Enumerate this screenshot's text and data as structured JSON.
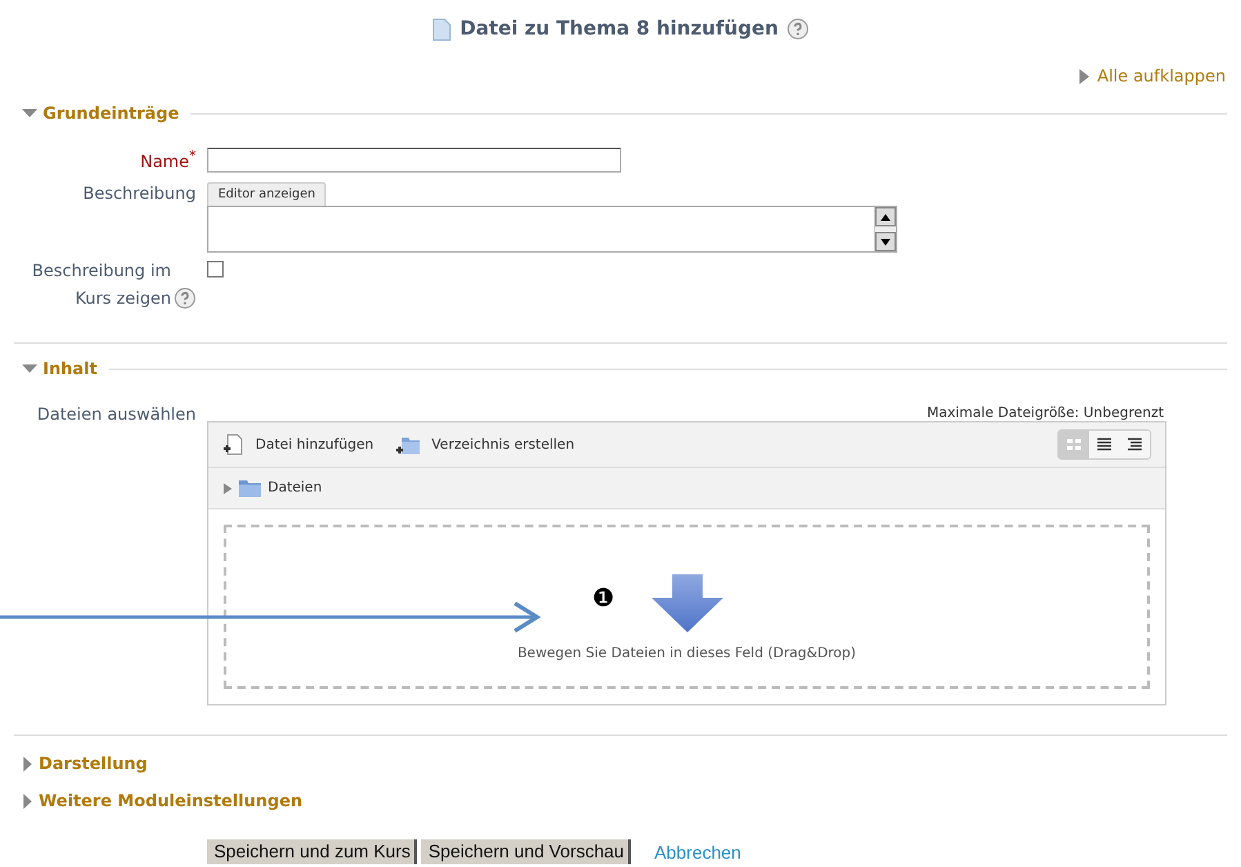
{
  "page_title": "Datei zu Thema 8 hinzufügen",
  "expand_all": "Alle aufklappen",
  "sections": [
    {
      "kind": "general",
      "title": "Grundeinträge",
      "expanded": true,
      "name_label": "Name",
      "required_mark": "*",
      "description_label": "Beschreibung",
      "editor_tab": "Editor anzeigen",
      "show_label": "Beschreibung im Kurs zeigen",
      "show_checked": false
    },
    {
      "kind": "content",
      "title": "Inhalt",
      "expanded": true,
      "files_label": "Dateien auswählen",
      "max_size": "Maximale Dateigröße: Unbegrenzt",
      "toolbar": [
        "Datei hinzufügen",
        "Verzeichnis erstellen"
      ],
      "views": [
        {
          "kind": "icons",
          "selected": true
        },
        {
          "kind": "list",
          "selected": false
        },
        {
          "kind": "tree",
          "selected": false
        }
      ],
      "folder": "Dateien",
      "drop_hint": "Bewegen Sie Dateien in dieses Feld (Drag&Drop)"
    },
    {
      "kind": "plain",
      "title": "Darstellung",
      "expanded": false
    },
    {
      "kind": "plain",
      "title": "Weitere Moduleinstellungen",
      "expanded": false
    }
  ],
  "buttons": [
    "Speichern und zum Kurs",
    "Speichern und Vorschau"
  ],
  "cancel": "Abbrechen",
  "annotation": {
    "marker": "❶"
  }
}
